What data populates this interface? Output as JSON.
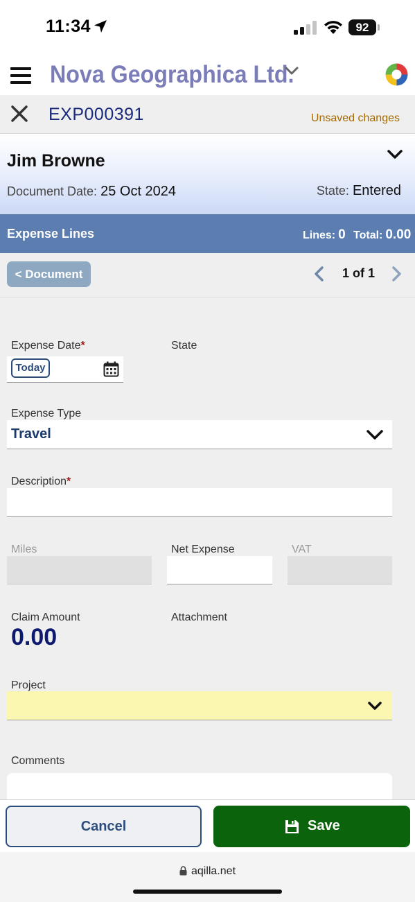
{
  "status_bar": {
    "time": "11:34",
    "battery": "92"
  },
  "header": {
    "company": "Nova Geographica Ltd."
  },
  "document": {
    "number": "EXP000391",
    "unsaved_text": "Unsaved changes",
    "employee": "Jim Browne",
    "date_label": "Document Date:",
    "date_value": "25 Oct 2024",
    "state_label": "State:",
    "state_value": "Entered"
  },
  "lines_bar": {
    "title": "Expense Lines",
    "lines_label": "Lines:",
    "lines_value": "0",
    "total_label": "Total:",
    "total_value": "0.00"
  },
  "pager": {
    "back_label": "< Document",
    "text": "1 of 1"
  },
  "form": {
    "expense_date_label": "Expense Date",
    "required_mark": "*",
    "today_label": "Today",
    "state_label": "State",
    "expense_type_label": "Expense Type",
    "expense_type_value": "Travel",
    "description_label": "Description",
    "description_value": "",
    "miles_label": "Miles",
    "net_expense_label": "Net Expense",
    "net_expense_value": "",
    "vat_label": "VAT",
    "claim_amount_label": "Claim Amount",
    "claim_amount_value": "0.00",
    "attachment_label": "Attachment",
    "project_label": "Project",
    "comments_label": "Comments"
  },
  "actions": {
    "cancel_label": "Cancel",
    "save_label": "Save"
  },
  "browser": {
    "url": "aqilla.net"
  },
  "colors": {
    "company": "#7b7db8",
    "doc_number": "#1a2a7c",
    "unsaved": "#a36a00",
    "lines_bar": "#5c7daf",
    "project_highlight": "#fbf7b0",
    "save_button": "#0b640b",
    "cancel_border": "#2c4d7c"
  },
  "icons": [
    "location-arrow-icon",
    "signal-icon",
    "wifi-icon",
    "battery-icon",
    "hamburger-menu-icon",
    "chevron-down-icon",
    "app-logo-icon",
    "close-icon",
    "chevron-left-icon",
    "chevron-right-icon",
    "calendar-icon",
    "floppy-disk-icon",
    "lock-icon"
  ]
}
